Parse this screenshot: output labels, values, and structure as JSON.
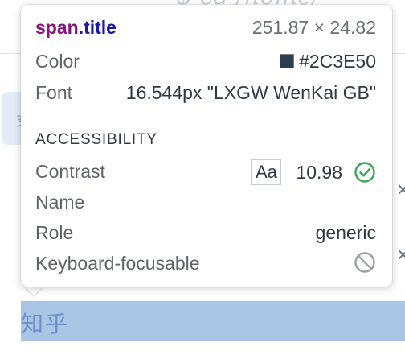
{
  "background": {
    "code_fragment": "$ cd /home/",
    "chip_text": "支",
    "highlight_text": "知乎",
    "highlight_color": "#A9C4E5"
  },
  "tooltip": {
    "selector_tag": "span",
    "selector_class": ".title",
    "dimensions": "251.87 × 24.82",
    "color_label": "Color",
    "color_value": "#2C3E50",
    "color_swatch": "#2C3E50",
    "font_label": "Font",
    "font_value": "16.544px \"LXGW WenKai GB\"",
    "section_title": "ACCESSIBILITY",
    "contrast_label": "Contrast",
    "contrast_badge": "Aa",
    "contrast_value": "10.98",
    "contrast_status_icon": "check-circle-icon",
    "name_label": "Name",
    "name_value": "",
    "role_label": "Role",
    "role_value": "generic",
    "keyboard_label": "Keyboard-focusable",
    "keyboard_status_icon": "ban-icon",
    "accent_green": "#3AA757",
    "icon_grey": "#9AA0A6"
  }
}
